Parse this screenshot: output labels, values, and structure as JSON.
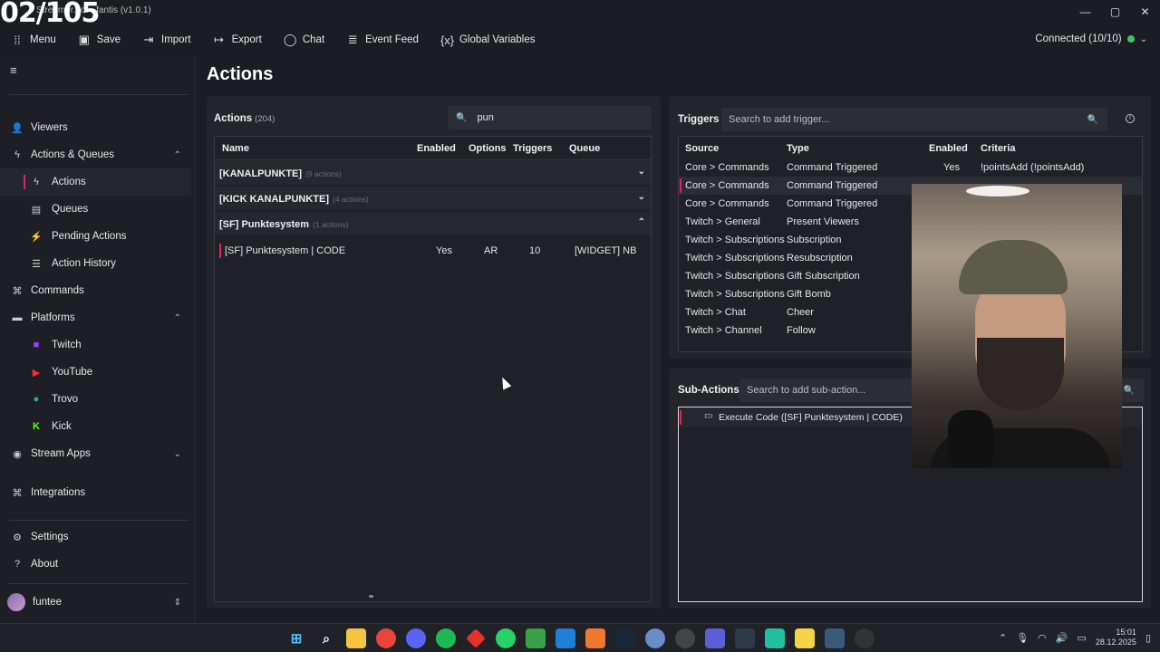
{
  "overlay_counter": "02/105",
  "window": {
    "title": "Streamer.bot - fantis (v1.0.1)"
  },
  "toolbar": {
    "menu": "Menu",
    "save": "Save",
    "import": "Import",
    "export": "Export",
    "chat": "Chat",
    "event_feed": "Event Feed",
    "global_variables": "Global Variables"
  },
  "connection": {
    "label": "Connected (10/10)",
    "color": "#3ec46d"
  },
  "sidebar": {
    "viewers": "Viewers",
    "actions_queues": "Actions & Queues",
    "actions": "Actions",
    "queues": "Queues",
    "pending_actions": "Pending Actions",
    "action_history": "Action History",
    "commands": "Commands",
    "platforms": "Platforms",
    "twitch": "Twitch",
    "youtube": "YouTube",
    "trovo": "Trovo",
    "kick": "Kick",
    "stream_apps": "Stream Apps",
    "integrations": "Integrations",
    "settings": "Settings",
    "about": "About",
    "user": "funtee"
  },
  "page": {
    "title": "Actions"
  },
  "actions": {
    "title": "Actions",
    "count": "(204)",
    "search_value": "pun",
    "columns": {
      "name": "Name",
      "enabled": "Enabled",
      "options": "Options",
      "triggers": "Triggers",
      "queue": "Queue"
    },
    "groups": [
      {
        "name": "[KANALPUNKTE]",
        "count": "(9 actions)"
      },
      {
        "name": "[KICK KANALPUNKTE]",
        "count": "(4 actions)"
      },
      {
        "name": "[SF] Punktesystem",
        "count": "(1 actions)"
      }
    ],
    "rows": [
      {
        "name": "[SF] Punktesystem | CODE",
        "enabled": "Yes",
        "options": "AR",
        "triggers": "10",
        "queue": "[WIDGET] NB"
      }
    ]
  },
  "triggers": {
    "title": "Triggers",
    "search_placeholder": "Search to add trigger...",
    "columns": {
      "source": "Source",
      "type": "Type",
      "enabled": "Enabled",
      "criteria": "Criteria"
    },
    "rows": [
      {
        "source": "Core > Commands",
        "type": "Command Triggered",
        "enabled": "Yes",
        "criteria": "!pointsAdd (!pointsAdd)"
      },
      {
        "source": "Core > Commands",
        "type": "Command Triggered",
        "enabled": "",
        "criteria": ""
      },
      {
        "source": "Core > Commands",
        "type": "Command Triggered",
        "enabled": "",
        "criteria": ""
      },
      {
        "source": "Twitch > General",
        "type": "Present Viewers",
        "enabled": "",
        "criteria": ""
      },
      {
        "source": "Twitch > Subscriptions",
        "type": "Subscription",
        "enabled": "",
        "criteria": ""
      },
      {
        "source": "Twitch > Subscriptions",
        "type": "Resubscription",
        "enabled": "",
        "criteria": ""
      },
      {
        "source": "Twitch > Subscriptions",
        "type": "Gift Subscription",
        "enabled": "",
        "criteria": ""
      },
      {
        "source": "Twitch > Subscriptions",
        "type": "Gift Bomb",
        "enabled": "",
        "criteria": ""
      },
      {
        "source": "Twitch > Chat",
        "type": "Cheer",
        "enabled": "",
        "criteria": ""
      },
      {
        "source": "Twitch > Channel",
        "type": "Follow",
        "enabled": "",
        "criteria": ""
      }
    ]
  },
  "subactions": {
    "title": "Sub-Actions",
    "search_placeholder": "Search to add sub-action...",
    "items": [
      {
        "label": "Execute Code ([SF] Punktesystem | CODE)"
      }
    ]
  },
  "taskbar": {
    "time": "15:01",
    "date": "28.12.2025"
  },
  "colors": {
    "accent": "#e0245e",
    "panel": "#23252b",
    "background": "#1b1d22"
  }
}
